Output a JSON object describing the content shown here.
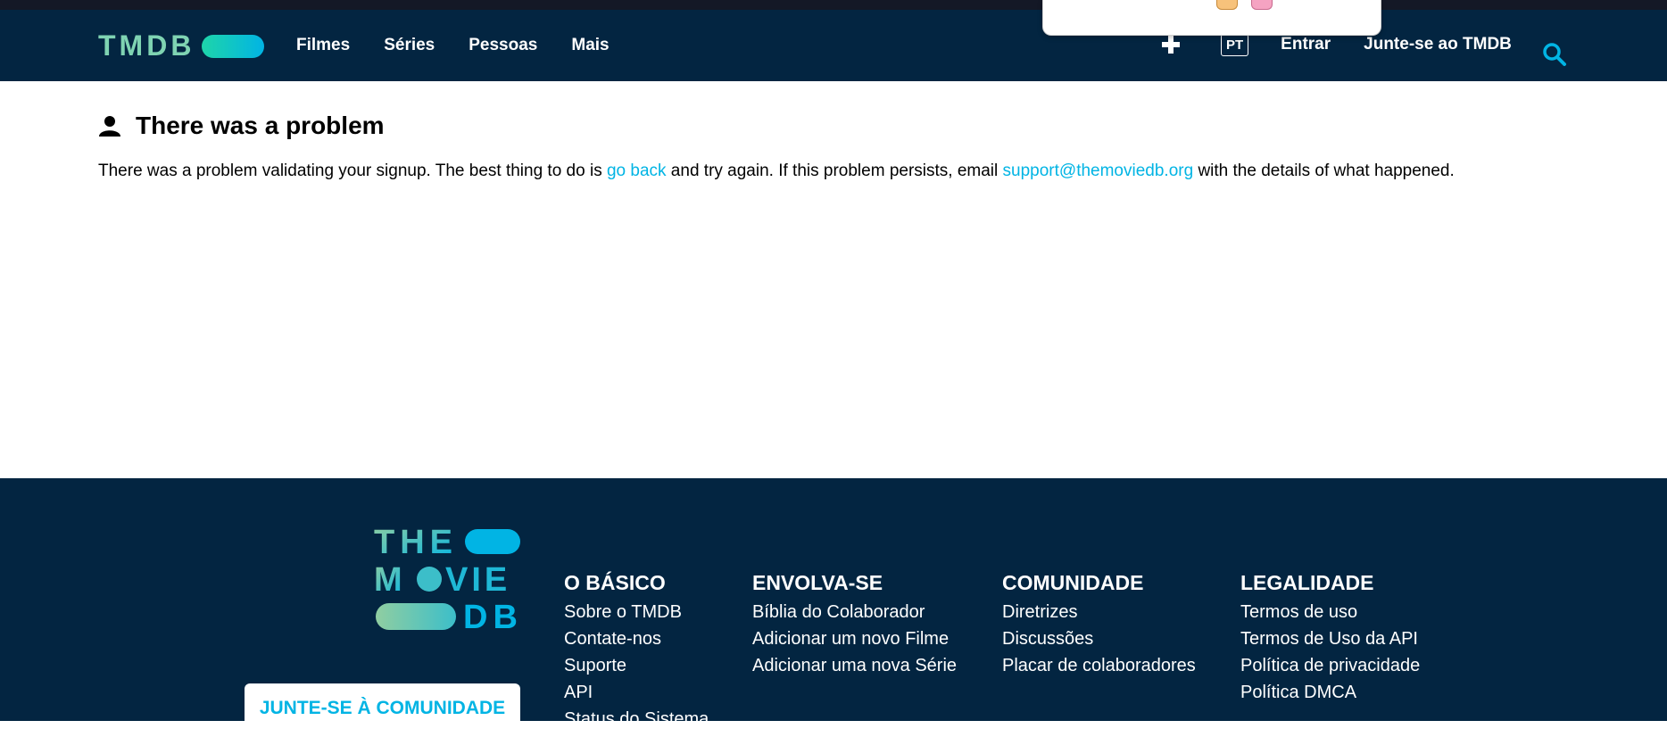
{
  "header": {
    "logo_text": "TMDB",
    "nav": [
      "Filmes",
      "Séries",
      "Pessoas",
      "Mais"
    ],
    "lang": "PT",
    "login": "Entrar",
    "join": "Junte-se ao TMDB"
  },
  "main": {
    "title": "There was a problem",
    "msg_part1": "There was a problem validating your signup. The best thing to do is ",
    "link_go_back": "go back",
    "msg_part2": " and try again. If this problem persists, email ",
    "link_email": "support@themoviedb.org",
    "msg_part3": " with the details of what happened."
  },
  "footer": {
    "join_button": "JUNTE-SE À COMUNIDADE",
    "columns": [
      {
        "title": "O BÁSICO",
        "links": [
          "Sobre o TMDB",
          "Contate-nos",
          "Suporte",
          "API",
          "Status do Sistema"
        ]
      },
      {
        "title": "ENVOLVA-SE",
        "links": [
          "Bíblia do Colaborador",
          "Adicionar um novo Filme",
          "Adicionar uma nova Série"
        ]
      },
      {
        "title": "COMUNIDADE",
        "links": [
          "Diretrizes",
          "Discussões",
          "Placar de colaboradores"
        ]
      },
      {
        "title": "LEGALIDADE",
        "links": [
          "Termos de uso",
          "Termos de Uso da API",
          "Política de privacidade",
          "Política DMCA"
        ]
      }
    ]
  },
  "colors": {
    "navy": "#032541",
    "accent": "#01b4e4",
    "green": "#90cea1"
  }
}
